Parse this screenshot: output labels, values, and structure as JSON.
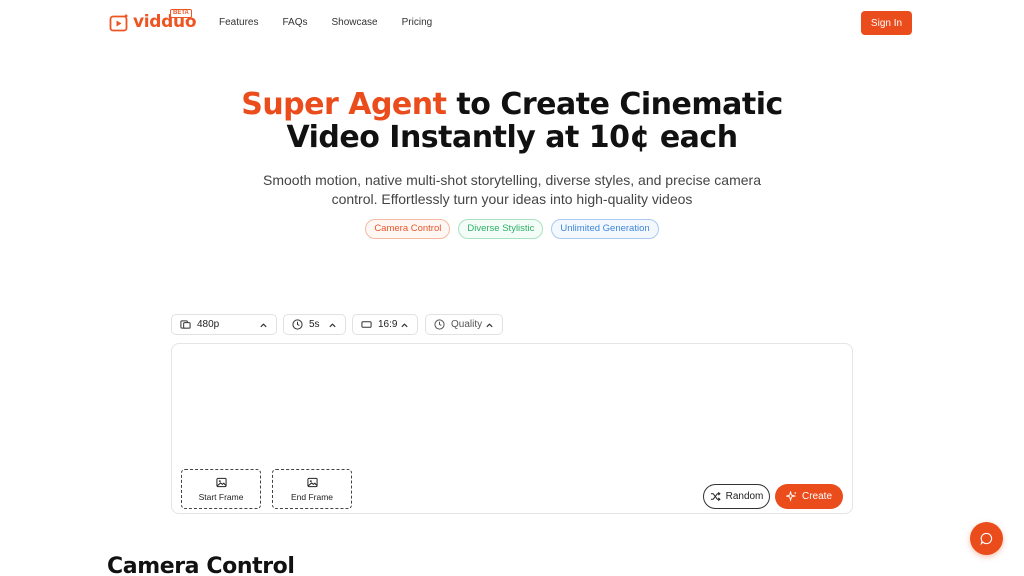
{
  "header": {
    "logo_text": "vidduo",
    "logo_badge": "BETA",
    "nav": [
      "Features",
      "FAQs",
      "Showcase",
      "Pricing"
    ],
    "signin_label": "Sign In"
  },
  "hero": {
    "title_accent": "Super Agent",
    "title_rest_line1": " to Create Cinematic",
    "title_line2": "Video Instantly at 10¢ each",
    "subtitle": "Smooth motion, native multi-shot storytelling, diverse styles, and precise camera control. Effortlessly turn your ideas into high-quality videos",
    "tags": [
      "Camera Control",
      "Diverse Stylistic",
      "Unlimited Generation"
    ]
  },
  "options": {
    "resolution": "480p",
    "duration": "5s",
    "aspect_ratio": "16:9",
    "quality": "Quality"
  },
  "prompt": {
    "start_frame_label": "Start Frame",
    "end_frame_label": "End Frame",
    "random_label": "Random",
    "create_label": "Create"
  },
  "section": {
    "title": "Camera Control"
  },
  "colors": {
    "accent": "#ea4c1c",
    "tag_green": "#2cb067",
    "tag_blue": "#3f86d8"
  }
}
